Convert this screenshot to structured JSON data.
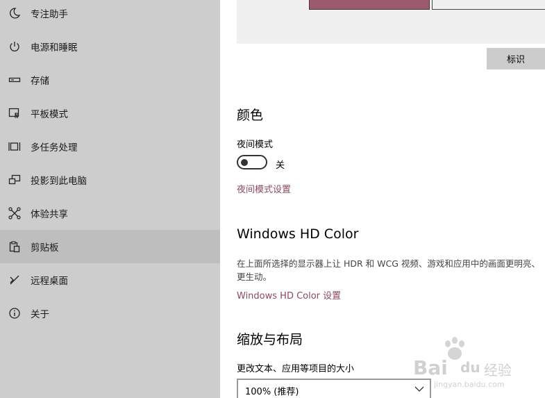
{
  "sidebar": {
    "items": [
      {
        "label": "专注助手",
        "icon": "moon-icon"
      },
      {
        "label": "电源和睡眠",
        "icon": "power-icon"
      },
      {
        "label": "存储",
        "icon": "storage-icon"
      },
      {
        "label": "平板模式",
        "icon": "tablet-mode-icon"
      },
      {
        "label": "多任务处理",
        "icon": "multitasking-icon"
      },
      {
        "label": "投影到此电脑",
        "icon": "project-icon"
      },
      {
        "label": "体验共享",
        "icon": "shared-experiences-icon"
      },
      {
        "label": "剪贴板",
        "icon": "clipboard-icon"
      },
      {
        "label": "远程桌面",
        "icon": "remote-desktop-icon"
      },
      {
        "label": "关于",
        "icon": "info-icon"
      }
    ],
    "selected_index": 7
  },
  "main": {
    "identify_label": "标识",
    "color": {
      "title": "颜色",
      "night_light_label": "夜间模式",
      "toggle_state": "关",
      "toggle_on": false,
      "settings_link": "夜间模式设置"
    },
    "hd_color": {
      "title": "Windows HD Color",
      "description": "在上面所选择的显示器上让 HDR 和 WCG 视频、游戏和应用中的画面更明亮、更生动。",
      "settings_link": "Windows HD Color 设置"
    },
    "scale": {
      "title": "缩放与布局",
      "size_label": "更改文本、应用等项目的大小",
      "size_value": "100% (推荐)"
    }
  },
  "watermark": {
    "brand": "Bai",
    "brand_suffix": "du",
    "cn": "经验",
    "url": "jingyan.baidu.com"
  },
  "colors": {
    "accent": "#8b4a5c",
    "monitor_selected": "#9b5b6c",
    "sidebar_bg": "#cdcdcd",
    "sidebar_selected": "#bebebe"
  }
}
